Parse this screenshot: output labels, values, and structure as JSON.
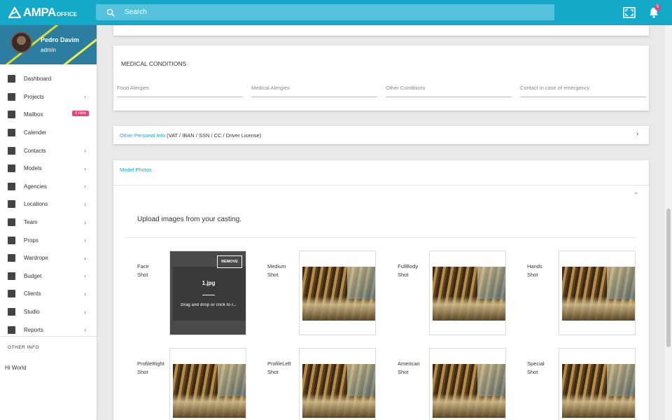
{
  "app": {
    "logo_main": "AMPA",
    "logo_sub": "OFFICE",
    "accent": "#15a9c9",
    "badge_color": "#ec407a"
  },
  "header": {
    "search_placeholder": "Search",
    "notification_count": "5",
    "icons": [
      "search-icon",
      "fullscreen-icon",
      "bell-icon"
    ]
  },
  "user": {
    "name": "Pedro Davim",
    "role": "admin"
  },
  "sidebar": {
    "items": [
      {
        "label": "Dashboard",
        "icon": "dashboard-icon",
        "has_children": false
      },
      {
        "label": "Projects",
        "icon": "projects-icon",
        "has_children": true
      },
      {
        "label": "Mailbox",
        "icon": "mail-icon",
        "badge": "4 new",
        "has_children": false
      },
      {
        "label": "Calender",
        "icon": "calendar-icon",
        "has_children": false
      },
      {
        "label": "Contacts",
        "icon": "contacts-icon",
        "has_children": true
      },
      {
        "label": "Models",
        "icon": "models-icon",
        "has_children": true
      },
      {
        "label": "Agencies",
        "icon": "agencies-icon",
        "has_children": true
      },
      {
        "label": "Locations",
        "icon": "locations-icon",
        "has_children": true
      },
      {
        "label": "Team",
        "icon": "team-icon",
        "has_children": true
      },
      {
        "label": "Props",
        "icon": "props-icon",
        "has_children": true
      },
      {
        "label": "Wardrope",
        "icon": "wardrope-icon",
        "has_children": true
      },
      {
        "label": "Budget",
        "icon": "cart-icon",
        "has_children": true
      },
      {
        "label": "Clients",
        "icon": "clients-icon",
        "has_children": true
      },
      {
        "label": "Studio",
        "icon": "studio-icon",
        "has_children": true
      },
      {
        "label": "Reports",
        "icon": "reports-icon",
        "has_children": true
      }
    ],
    "other_info_heading": "OTHER INFO",
    "other_info_text": "Hi World"
  },
  "medical": {
    "title": "MEDICAL CONDITIONS",
    "fields": [
      {
        "placeholder": "Food Alergies",
        "value": ""
      },
      {
        "placeholder": "Medical Alergies",
        "value": ""
      },
      {
        "placeholder": "Other Conditions",
        "value": ""
      },
      {
        "placeholder": "Contact in case of emergency",
        "value": ""
      }
    ]
  },
  "other_personal": {
    "link": "Other Personal Info",
    "rest": " (VAT / IBAN / SSN / CC / Driver License)"
  },
  "photos": {
    "title": "Model Photos",
    "upload_title": "Upload images from your casting.",
    "face": {
      "label_line1": "Face",
      "label_line2": "Shot",
      "remove_label": "REMOVE",
      "file_name": "1.jpg",
      "drop_hint": "Drag and drop or click to r..."
    },
    "shots": [
      {
        "line1": "Medium",
        "line2": "Shot"
      },
      {
        "line1": "FullBody",
        "line2": "Shot"
      },
      {
        "line1": "Hands",
        "line2": "Shot"
      },
      {
        "line1": "ProfileRight",
        "line2": "Shot"
      },
      {
        "line1": "ProfileLeft",
        "line2": "Shot"
      },
      {
        "line1": "American",
        "line2": "Shot"
      },
      {
        "line1": "Special",
        "line2": "Shot"
      }
    ]
  }
}
